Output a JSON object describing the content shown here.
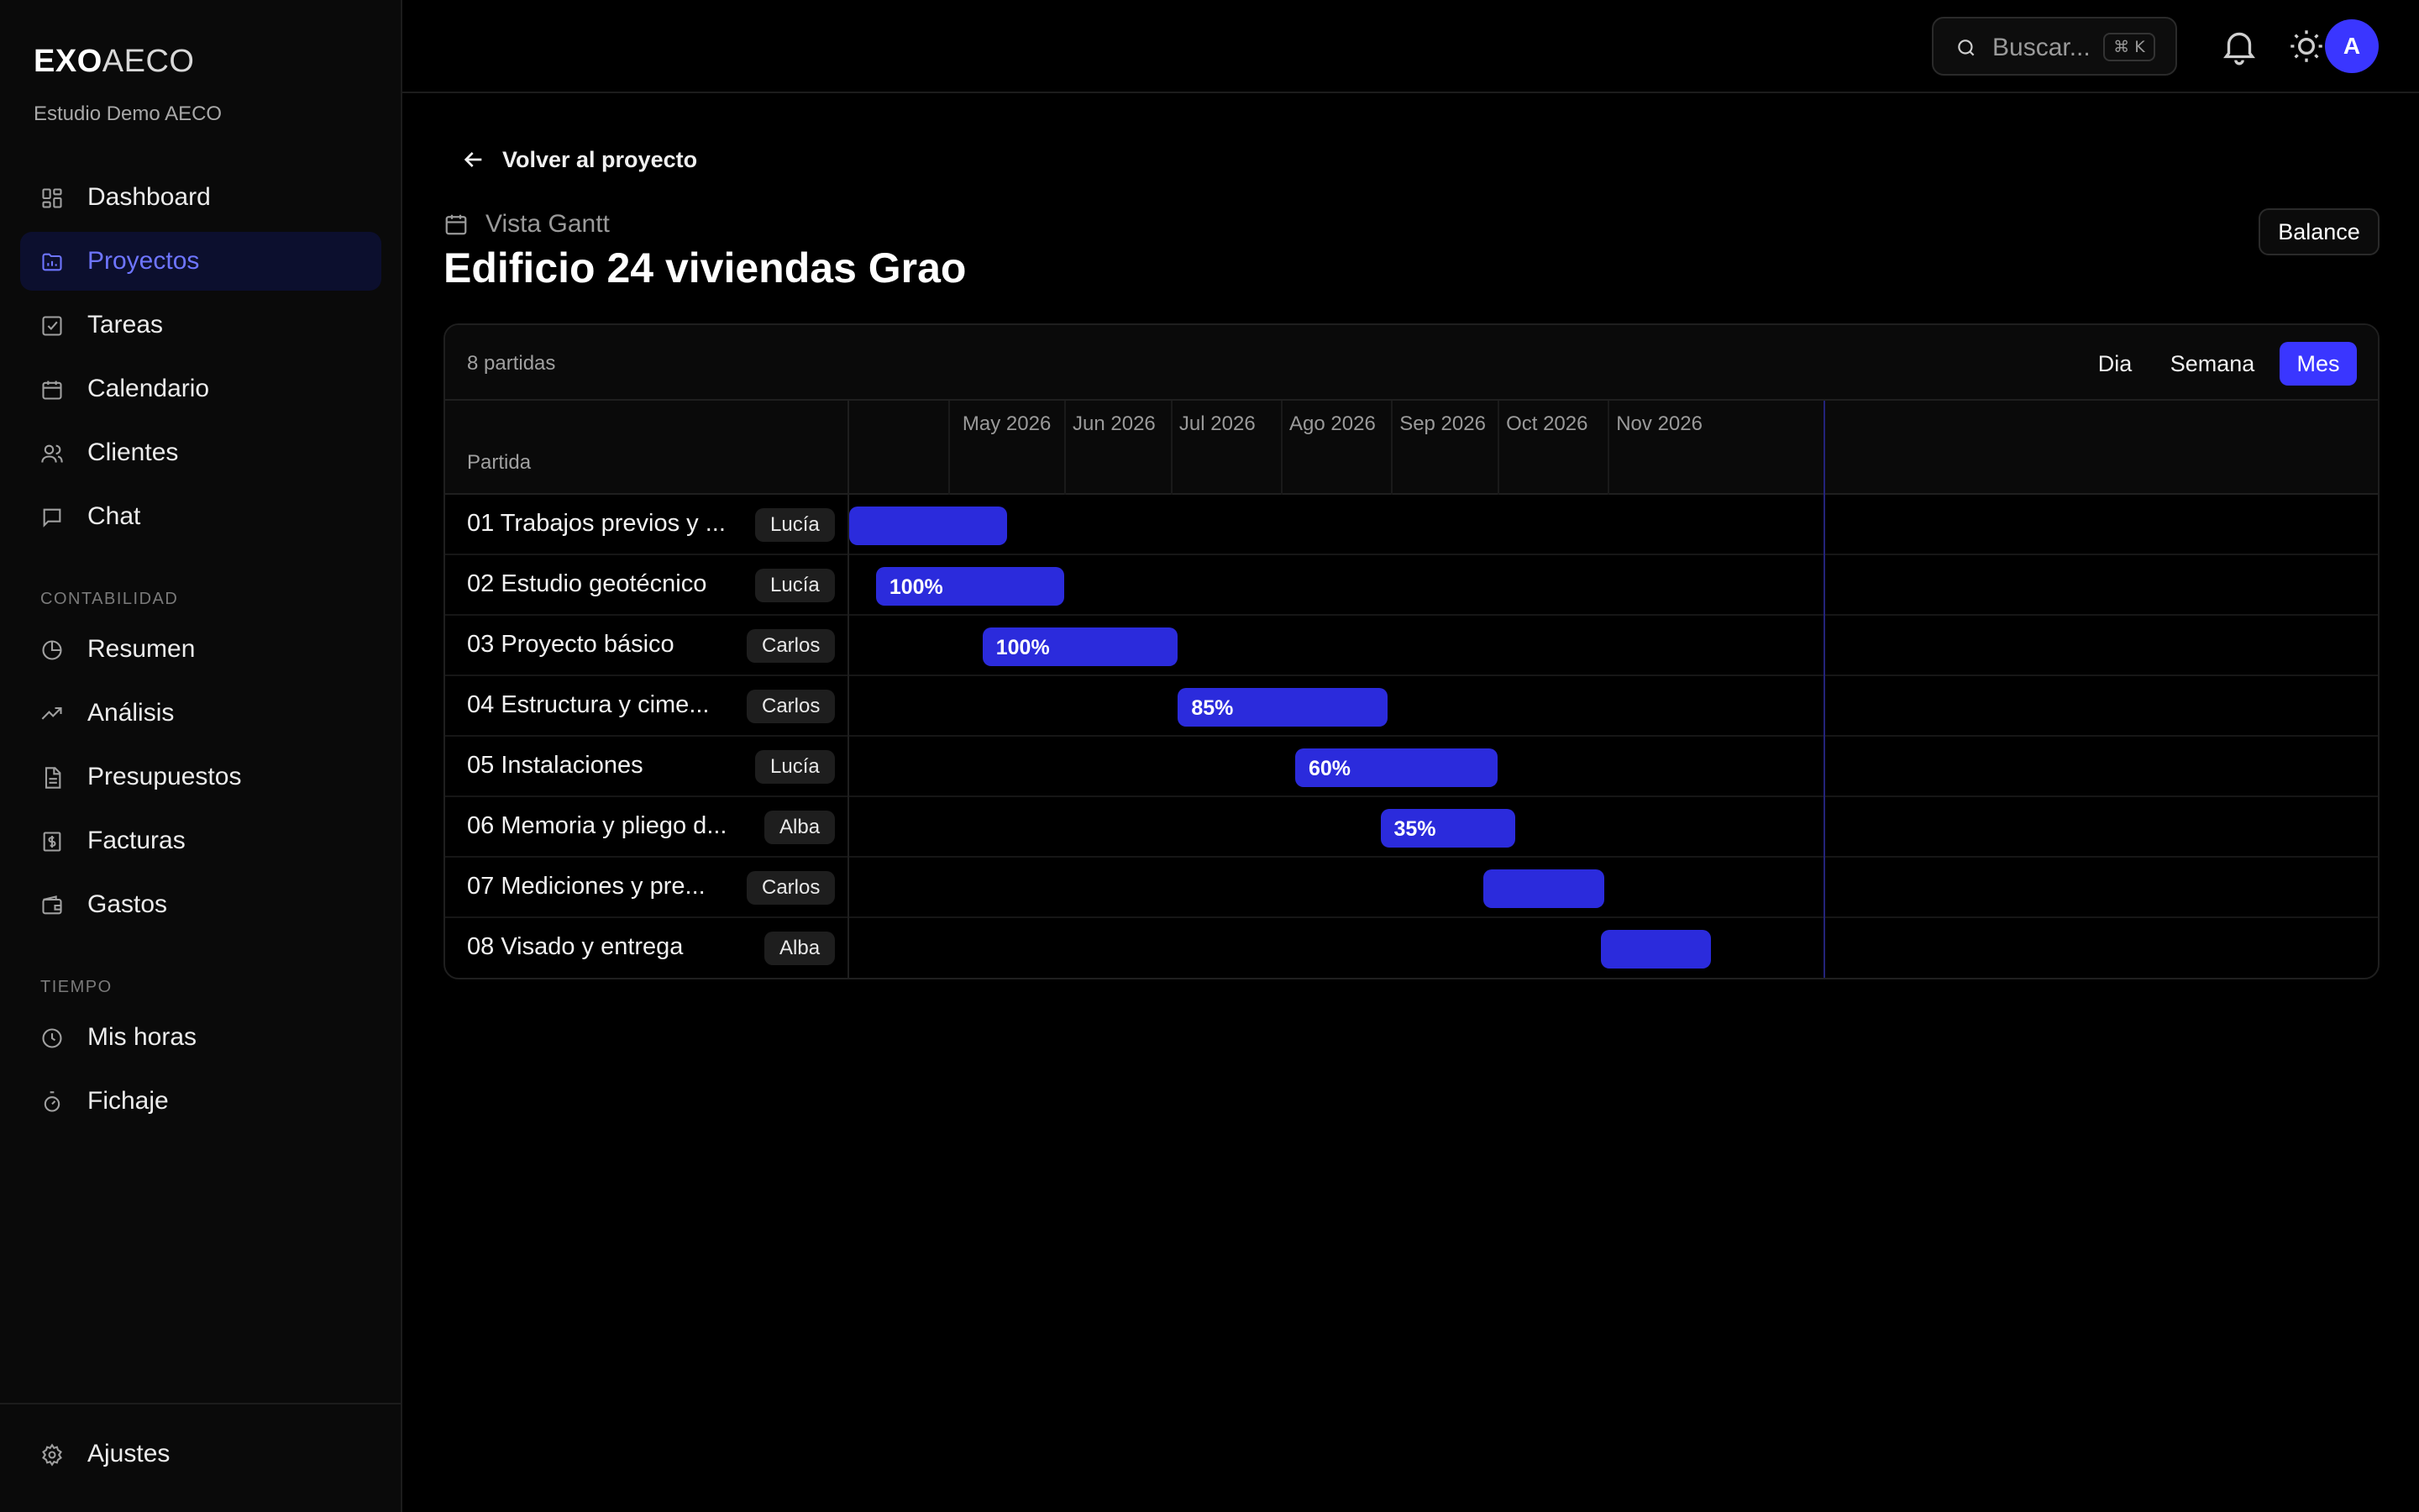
{
  "app": {
    "brand_bold": "EXO",
    "brand_light": "AECO",
    "org": "Estudio Demo AECO"
  },
  "sidebar": {
    "main": [
      {
        "label": "Dashboard",
        "icon": "grid-icon"
      },
      {
        "label": "Proyectos",
        "icon": "folder-chart-icon",
        "active": true
      },
      {
        "label": "Tareas",
        "icon": "checkbox-icon"
      },
      {
        "label": "Calendario",
        "icon": "calendar-icon"
      },
      {
        "label": "Clientes",
        "icon": "users-icon"
      },
      {
        "label": "Chat",
        "icon": "chat-icon"
      }
    ],
    "section_accounting": "CONTABILIDAD",
    "accounting": [
      {
        "label": "Resumen",
        "icon": "pie-icon"
      },
      {
        "label": "Análisis",
        "icon": "trend-icon"
      },
      {
        "label": "Presupuestos",
        "icon": "document-icon"
      },
      {
        "label": "Facturas",
        "icon": "invoice-icon"
      },
      {
        "label": "Gastos",
        "icon": "wallet-icon"
      }
    ],
    "section_time": "TIEMPO",
    "time": [
      {
        "label": "Mis horas",
        "icon": "clock-icon"
      },
      {
        "label": "Fichaje",
        "icon": "stopwatch-icon"
      }
    ],
    "footer": {
      "label": "Ajustes",
      "icon": "gear-icon"
    }
  },
  "topbar": {
    "search_placeholder": "Buscar...",
    "shortcut": "⌘ K",
    "avatar_initial": "A"
  },
  "page": {
    "back_label": "Volver al proyecto",
    "view_label": "Vista Gantt",
    "title": "Edificio 24 viviendas Grao",
    "balance_button": "Balance"
  },
  "gantt": {
    "count_label": "8 partidas",
    "views": [
      "Dia",
      "Semana",
      "Mes"
    ],
    "active_view": "Mes",
    "column_header": "Partida",
    "months": [
      "May 2026",
      "Jun 2026",
      "Jul 2026",
      "Ago 2026",
      "Sep 2026",
      "Oct 2026",
      "Nov 2026"
    ],
    "bar_color": "#2b2bdc",
    "accent": "#3a36ff",
    "tasks": [
      {
        "name": "01 Trabajos previos y ...",
        "assignee": "Lucía",
        "progress": "",
        "start": "2026-04-01",
        "end": "2026-05-16"
      },
      {
        "name": "02 Estudio geotécnico",
        "assignee": "Lucía",
        "progress": "100%",
        "start": "2026-04-09",
        "end": "2026-06-01"
      },
      {
        "name": "03 Proyecto básico",
        "assignee": "Carlos",
        "progress": "100%",
        "start": "2026-05-09",
        "end": "2026-07-03"
      },
      {
        "name": "04 Estructura y cime...",
        "assignee": "Carlos",
        "progress": "85%",
        "start": "2026-07-03",
        "end": "2026-08-31"
      },
      {
        "name": "05 Instalaciones",
        "assignee": "Lucía",
        "progress": "60%",
        "start": "2026-08-05",
        "end": "2026-10-01"
      },
      {
        "name": "06 Memoria y pliego d...",
        "assignee": "Alba",
        "progress": "35%",
        "start": "2026-08-29",
        "end": "2026-10-06"
      },
      {
        "name": "07 Mediciones y pre...",
        "assignee": "Carlos",
        "progress": "",
        "start": "2026-09-27",
        "end": "2026-10-31"
      },
      {
        "name": "08 Visado y entrega",
        "assignee": "Alba",
        "progress": "",
        "start": "2026-10-30",
        "end": "2026-11-30"
      }
    ]
  }
}
